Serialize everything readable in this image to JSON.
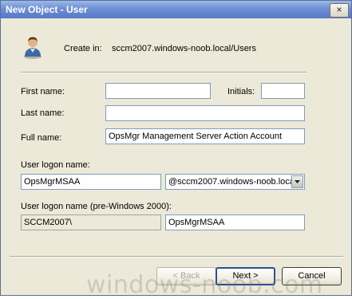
{
  "window": {
    "title": "New Object - User",
    "close_glyph": "×"
  },
  "header": {
    "create_in_label": "Create in:",
    "create_in_value": "sccm2007.windows-noob.local/Users",
    "icon": "user-icon"
  },
  "form": {
    "first_name": {
      "label": "First name:",
      "value": ""
    },
    "initials": {
      "label": "Initials:",
      "value": ""
    },
    "last_name": {
      "label": "Last name:",
      "value": ""
    },
    "full_name": {
      "label": "Full name:",
      "value": "OpsMgr Management Server Action Account"
    },
    "logon": {
      "label": "User logon name:",
      "value": "OpsMgrMSAA",
      "domain": "@sccm2007.windows-noob.local"
    },
    "pre2000": {
      "label": "User logon name (pre-Windows 2000):",
      "domain_prefix": "SCCM2007\\",
      "value": "OpsMgrMSAA"
    }
  },
  "buttons": {
    "back": "< Back",
    "next": "Next >",
    "cancel": "Cancel"
  },
  "watermark": "windows-noob.com"
}
